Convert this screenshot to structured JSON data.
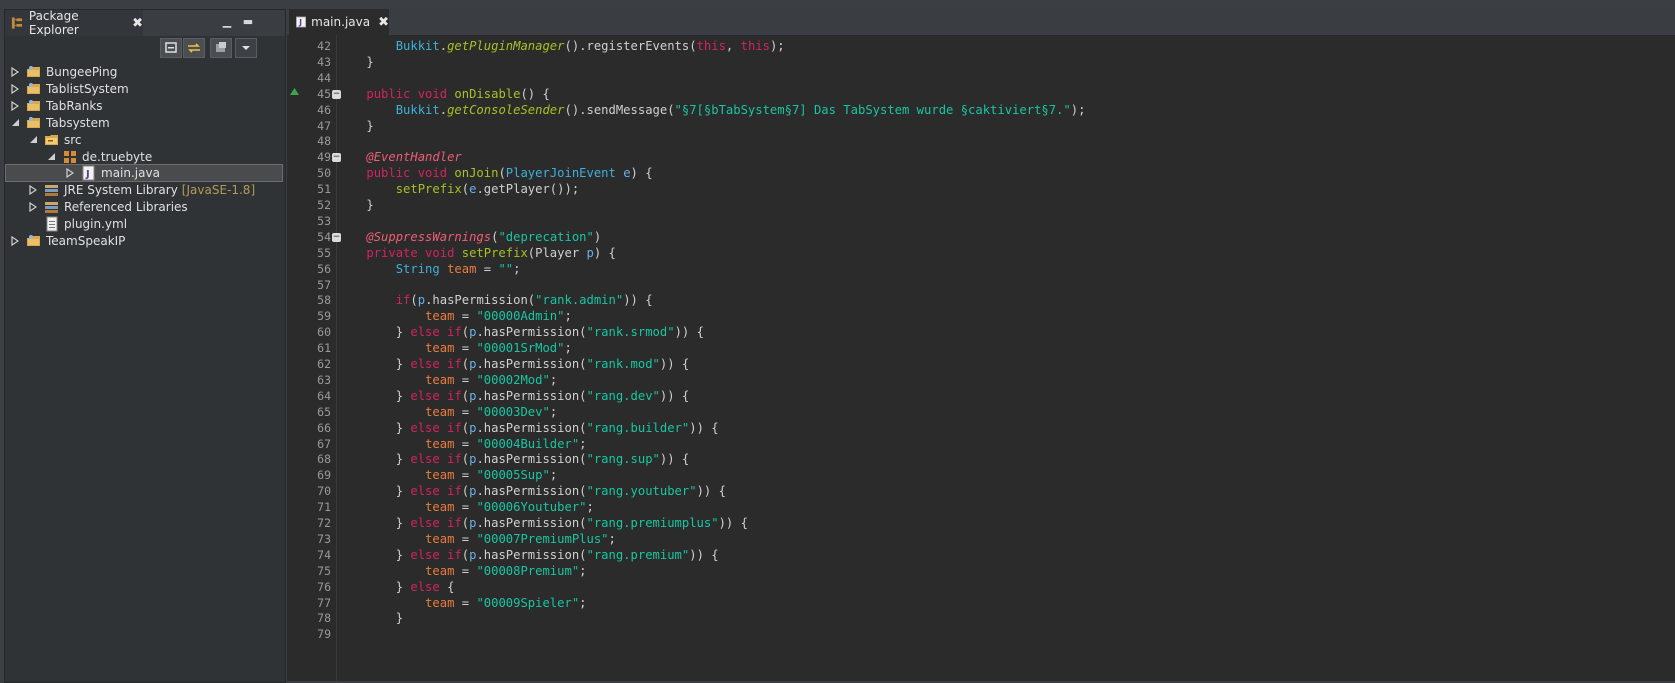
{
  "explorer": {
    "title": "Package Explorer",
    "tree": [
      {
        "label": "BungeePing",
        "suffix": ""
      },
      {
        "label": "TablistSystem",
        "suffix": ""
      },
      {
        "label": "TabRanks",
        "suffix": ""
      },
      {
        "label": "Tabsystem",
        "suffix": ""
      },
      {
        "label": "src",
        "suffix": ""
      },
      {
        "label": "de.truebyte",
        "suffix": ""
      },
      {
        "label": "main.java",
        "suffix": ""
      },
      {
        "label": "JRE System Library",
        "suffix": "[JavaSE-1.8]"
      },
      {
        "label": "Referenced Libraries",
        "suffix": ""
      },
      {
        "label": "plugin.yml",
        "suffix": ""
      },
      {
        "label": "TeamSpeakIP",
        "suffix": ""
      }
    ]
  },
  "editor": {
    "tab_label": "main.java",
    "lines": [
      {
        "num": "42",
        "tokens": [
          [
            "plain",
            "        "
          ],
          [
            "cls",
            "Bukkit"
          ],
          [
            "plain",
            "."
          ],
          [
            "smth",
            "getPluginManager"
          ],
          [
            "plain",
            "().registerEvents("
          ],
          [
            "kw",
            "this"
          ],
          [
            "plain",
            ", "
          ],
          [
            "kw",
            "this"
          ],
          [
            "plain",
            ");"
          ]
        ]
      },
      {
        "num": "43",
        "tokens": [
          [
            "plain",
            "    }"
          ]
        ]
      },
      {
        "num": "44",
        "tokens": []
      },
      {
        "num": "45",
        "tokens": [
          [
            "plain",
            "    "
          ],
          [
            "kw",
            "public void "
          ],
          [
            "mth",
            "onDisable"
          ],
          [
            "plain",
            "() {"
          ]
        ]
      },
      {
        "num": "46",
        "tokens": [
          [
            "plain",
            "        "
          ],
          [
            "cls",
            "Bukkit"
          ],
          [
            "plain",
            "."
          ],
          [
            "smth",
            "getConsoleSender"
          ],
          [
            "plain",
            "().sendMessage("
          ],
          [
            "str",
            "\"§7[§bTabSystem§7] Das TabSystem wurde §caktiviert§7.\""
          ],
          [
            "plain",
            ");"
          ]
        ]
      },
      {
        "num": "47",
        "tokens": [
          [
            "plain",
            "    }"
          ]
        ]
      },
      {
        "num": "48",
        "tokens": []
      },
      {
        "num": "49",
        "tokens": [
          [
            "plain",
            "    "
          ],
          [
            "ann",
            "@EventHandler"
          ]
        ]
      },
      {
        "num": "50",
        "tokens": [
          [
            "plain",
            "    "
          ],
          [
            "kw",
            "public void "
          ],
          [
            "mth",
            "onJoin"
          ],
          [
            "plain",
            "("
          ],
          [
            "cls",
            "PlayerJoinEvent "
          ],
          [
            "par",
            "e"
          ],
          [
            "plain",
            ") {"
          ]
        ]
      },
      {
        "num": "51",
        "tokens": [
          [
            "plain",
            "        "
          ],
          [
            "mth",
            "setPrefix"
          ],
          [
            "plain",
            "("
          ],
          [
            "par",
            "e"
          ],
          [
            "plain",
            ".getPlayer());"
          ]
        ]
      },
      {
        "num": "52",
        "tokens": [
          [
            "plain",
            "    }"
          ]
        ]
      },
      {
        "num": "53",
        "tokens": []
      },
      {
        "num": "54",
        "tokens": [
          [
            "plain",
            "    "
          ],
          [
            "ann",
            "@SuppressWarnings"
          ],
          [
            "plain",
            "("
          ],
          [
            "str",
            "\"deprecation\""
          ],
          [
            "plain",
            ")"
          ]
        ]
      },
      {
        "num": "55",
        "tokens": [
          [
            "plain",
            "    "
          ],
          [
            "kw",
            "private void "
          ],
          [
            "mth",
            "setPrefix"
          ],
          [
            "plain",
            "(Player "
          ],
          [
            "par",
            "p"
          ],
          [
            "plain",
            ") {"
          ]
        ]
      },
      {
        "num": "56",
        "tokens": [
          [
            "plain",
            "        "
          ],
          [
            "cls",
            "String "
          ],
          [
            "var",
            "team"
          ],
          [
            "plain",
            " = "
          ],
          [
            "str",
            "\"\""
          ],
          [
            "plain",
            ";"
          ]
        ]
      },
      {
        "num": "57",
        "tokens": []
      },
      {
        "num": "58",
        "tokens": [
          [
            "plain",
            "        "
          ],
          [
            "kw",
            "if"
          ],
          [
            "plain",
            "("
          ],
          [
            "par",
            "p"
          ],
          [
            "plain",
            ".hasPermission("
          ],
          [
            "str",
            "\"rank.admin\""
          ],
          [
            "plain",
            ")) {"
          ]
        ]
      },
      {
        "num": "59",
        "tokens": [
          [
            "plain",
            "            "
          ],
          [
            "var",
            "team"
          ],
          [
            "plain",
            " = "
          ],
          [
            "str",
            "\"00000Admin\""
          ],
          [
            "plain",
            ";"
          ]
        ]
      },
      {
        "num": "60",
        "tokens": [
          [
            "plain",
            "        } "
          ],
          [
            "kw",
            "else if"
          ],
          [
            "plain",
            "("
          ],
          [
            "par",
            "p"
          ],
          [
            "plain",
            ".hasPermission("
          ],
          [
            "str",
            "\"rank.srmod\""
          ],
          [
            "plain",
            ")) {"
          ]
        ]
      },
      {
        "num": "61",
        "tokens": [
          [
            "plain",
            "            "
          ],
          [
            "var",
            "team"
          ],
          [
            "plain",
            " = "
          ],
          [
            "str",
            "\"00001SrMod\""
          ],
          [
            "plain",
            ";"
          ]
        ]
      },
      {
        "num": "62",
        "tokens": [
          [
            "plain",
            "        } "
          ],
          [
            "kw",
            "else if"
          ],
          [
            "plain",
            "("
          ],
          [
            "par",
            "p"
          ],
          [
            "plain",
            ".hasPermission("
          ],
          [
            "str",
            "\"rank.mod\""
          ],
          [
            "plain",
            ")) {"
          ]
        ]
      },
      {
        "num": "63",
        "tokens": [
          [
            "plain",
            "            "
          ],
          [
            "var",
            "team"
          ],
          [
            "plain",
            " = "
          ],
          [
            "str",
            "\"00002Mod\""
          ],
          [
            "plain",
            ";"
          ]
        ]
      },
      {
        "num": "64",
        "tokens": [
          [
            "plain",
            "        } "
          ],
          [
            "kw",
            "else if"
          ],
          [
            "plain",
            "("
          ],
          [
            "par",
            "p"
          ],
          [
            "plain",
            ".hasPermission("
          ],
          [
            "str",
            "\"rang.dev\""
          ],
          [
            "plain",
            ")) {"
          ]
        ]
      },
      {
        "num": "65",
        "tokens": [
          [
            "plain",
            "            "
          ],
          [
            "var",
            "team"
          ],
          [
            "plain",
            " = "
          ],
          [
            "str",
            "\"00003Dev\""
          ],
          [
            "plain",
            ";"
          ]
        ]
      },
      {
        "num": "66",
        "tokens": [
          [
            "plain",
            "        } "
          ],
          [
            "kw",
            "else if"
          ],
          [
            "plain",
            "("
          ],
          [
            "par",
            "p"
          ],
          [
            "plain",
            ".hasPermission("
          ],
          [
            "str",
            "\"rang.builder\""
          ],
          [
            "plain",
            ")) {"
          ]
        ]
      },
      {
        "num": "67",
        "tokens": [
          [
            "plain",
            "            "
          ],
          [
            "var",
            "team"
          ],
          [
            "plain",
            " = "
          ],
          [
            "str",
            "\"00004Builder\""
          ],
          [
            "plain",
            ";"
          ]
        ]
      },
      {
        "num": "68",
        "tokens": [
          [
            "plain",
            "        } "
          ],
          [
            "kw",
            "else if"
          ],
          [
            "plain",
            "("
          ],
          [
            "par",
            "p"
          ],
          [
            "plain",
            ".hasPermission("
          ],
          [
            "str",
            "\"rang.sup\""
          ],
          [
            "plain",
            ")) {"
          ]
        ]
      },
      {
        "num": "69",
        "tokens": [
          [
            "plain",
            "            "
          ],
          [
            "var",
            "team"
          ],
          [
            "plain",
            " = "
          ],
          [
            "str",
            "\"00005Sup\""
          ],
          [
            "plain",
            ";"
          ]
        ]
      },
      {
        "num": "70",
        "tokens": [
          [
            "plain",
            "        } "
          ],
          [
            "kw",
            "else if"
          ],
          [
            "plain",
            "("
          ],
          [
            "par",
            "p"
          ],
          [
            "plain",
            ".hasPermission("
          ],
          [
            "str",
            "\"rang.youtuber\""
          ],
          [
            "plain",
            ")) {"
          ]
        ]
      },
      {
        "num": "71",
        "tokens": [
          [
            "plain",
            "            "
          ],
          [
            "var",
            "team"
          ],
          [
            "plain",
            " = "
          ],
          [
            "str",
            "\"00006Youtuber\""
          ],
          [
            "plain",
            ";"
          ]
        ]
      },
      {
        "num": "72",
        "tokens": [
          [
            "plain",
            "        } "
          ],
          [
            "kw",
            "else if"
          ],
          [
            "plain",
            "("
          ],
          [
            "par",
            "p"
          ],
          [
            "plain",
            ".hasPermission("
          ],
          [
            "str",
            "\"rang.premiumplus\""
          ],
          [
            "plain",
            ")) {"
          ]
        ]
      },
      {
        "num": "73",
        "tokens": [
          [
            "plain",
            "            "
          ],
          [
            "var",
            "team"
          ],
          [
            "plain",
            " = "
          ],
          [
            "str",
            "\"00007PremiumPlus\""
          ],
          [
            "plain",
            ";"
          ]
        ]
      },
      {
        "num": "74",
        "tokens": [
          [
            "plain",
            "        } "
          ],
          [
            "kw",
            "else if"
          ],
          [
            "plain",
            "("
          ],
          [
            "par",
            "p"
          ],
          [
            "plain",
            ".hasPermission("
          ],
          [
            "str",
            "\"rang.premium\""
          ],
          [
            "plain",
            ")) {"
          ]
        ]
      },
      {
        "num": "75",
        "tokens": [
          [
            "plain",
            "            "
          ],
          [
            "var",
            "team"
          ],
          [
            "plain",
            " = "
          ],
          [
            "str",
            "\"00008Premium\""
          ],
          [
            "plain",
            ";"
          ]
        ]
      },
      {
        "num": "76",
        "tokens": [
          [
            "plain",
            "        } "
          ],
          [
            "kw",
            "else"
          ],
          [
            "plain",
            " {"
          ]
        ]
      },
      {
        "num": "77",
        "tokens": [
          [
            "plain",
            "            "
          ],
          [
            "var",
            "team"
          ],
          [
            "plain",
            " = "
          ],
          [
            "str",
            "\"00009Spieler\""
          ],
          [
            "plain",
            ";"
          ]
        ]
      },
      {
        "num": "78",
        "tokens": [
          [
            "plain",
            "        }"
          ]
        ]
      },
      {
        "num": "79",
        "tokens": []
      }
    ]
  },
  "colors": {
    "keyword": "#d2235f",
    "class": "#3fb0d9",
    "method": "#a8c023",
    "string": "#17c6a3",
    "variable": "#e87d3e",
    "annotation": "#ef5d74",
    "background": "#2b2b2b"
  }
}
